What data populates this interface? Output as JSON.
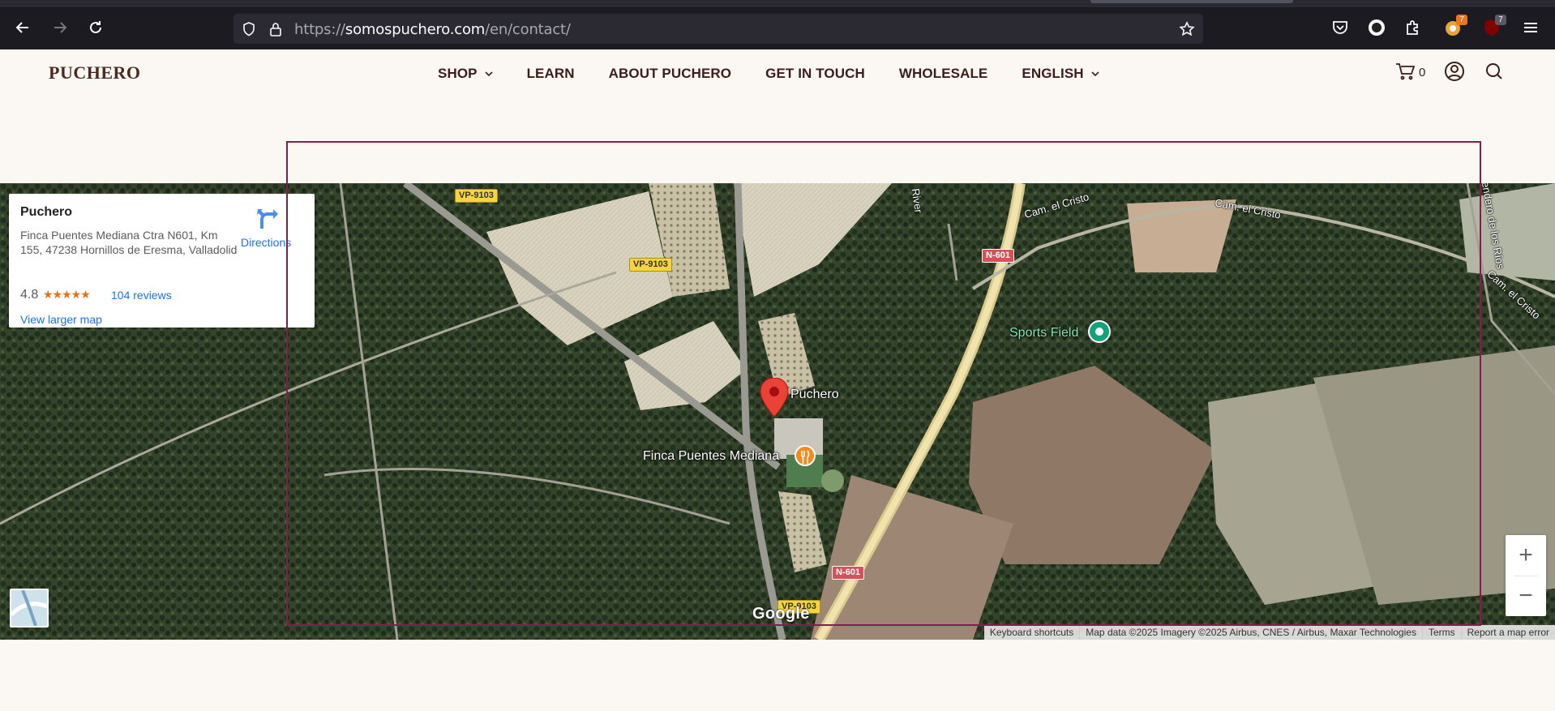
{
  "browser": {
    "url_prefix": "https://",
    "url_domain": "somospuchero.com",
    "url_path": "/en/contact/",
    "extension_badges": [
      "7",
      "7"
    ]
  },
  "site": {
    "logo": "PUCHERO",
    "menu": [
      {
        "label": "SHOP",
        "has_dropdown": true
      },
      {
        "label": "LEARN",
        "has_dropdown": false
      },
      {
        "label": "ABOUT PUCHERO",
        "has_dropdown": false
      },
      {
        "label": "GET IN TOUCH",
        "has_dropdown": false
      },
      {
        "label": "WHOLESALE",
        "has_dropdown": false
      },
      {
        "label": "ENGLISH",
        "has_dropdown": true
      }
    ],
    "cart_count": "0"
  },
  "map": {
    "info_card": {
      "title": "Puchero",
      "address": "Finca Puentes Mediana Ctra N601, Km 155, 47238 Hornillos de Eresma, Valladolid",
      "rating": "4.8",
      "stars": "★★★★★",
      "reviews": "104 reviews",
      "larger_map": "View larger map",
      "directions": "Directions"
    },
    "places": {
      "main_pin": "Puchero",
      "restaurant": "Finca Puentes Mediana",
      "sports": "Sports Field"
    },
    "roads": {
      "vp1": "VP-9103",
      "vp2": "VP-9103",
      "vp3": "VP-9103",
      "n1": "N-601",
      "n2": "N-601",
      "cam1": "Cam. el Cristo",
      "cam2": "Cam. el Cristo",
      "cam3": "Cam. el Cristo",
      "sendero": "Sendero de los Ríos",
      "river": "River"
    },
    "google": "Google",
    "attribution": {
      "shortcuts": "Keyboard shortcuts",
      "data": "Map data ©2025 Imagery ©2025 Airbus, CNES / Airbus, Maxar Technologies",
      "terms": "Terms",
      "report": "Report a map error"
    },
    "zoom_in": "+",
    "zoom_out": "−"
  },
  "colors": {
    "brand": "#3b1d1a",
    "link": "#1a73e8",
    "pin": "#ea4335",
    "selection": "#8a1a4a"
  }
}
